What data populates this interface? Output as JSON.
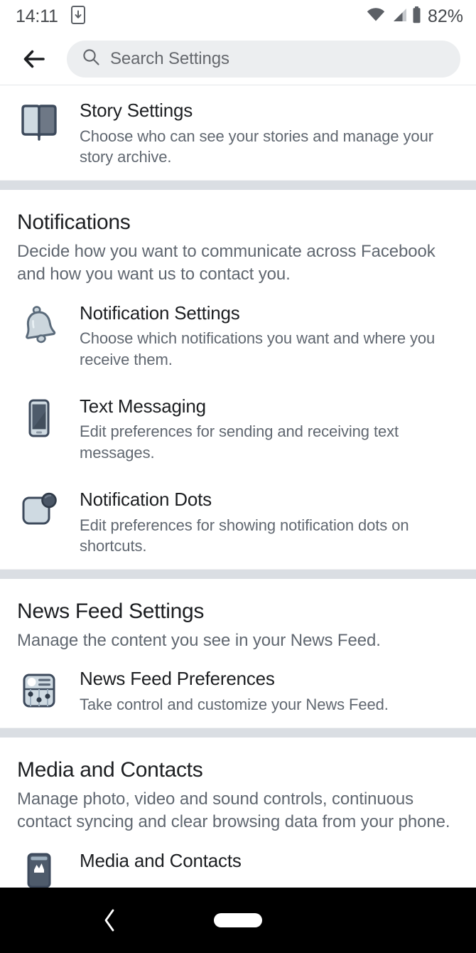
{
  "status_bar": {
    "time": "14:11",
    "battery_percent": "82%",
    "icons": [
      "phone-download-icon",
      "wifi-icon",
      "cellular-signal-icon",
      "battery-icon"
    ]
  },
  "header": {
    "back_label": "back-arrow",
    "search_placeholder": "Search Settings",
    "search_value": ""
  },
  "sections": [
    {
      "id": "story",
      "title": "",
      "subtitle": "",
      "rows": [
        {
          "icon": "book-icon",
          "title": "Story Settings",
          "subtitle": "Choose who can see your stories and manage your story archive."
        }
      ]
    },
    {
      "id": "notifications",
      "title": "Notifications",
      "subtitle": "Decide how you want to communicate across Facebook and how you want us to contact you.",
      "rows": [
        {
          "icon": "bell-icon",
          "title": "Notification Settings",
          "subtitle": "Choose which notifications you want and where you receive them."
        },
        {
          "icon": "smartphone-icon",
          "title": "Text Messaging",
          "subtitle": "Edit preferences for sending and receiving text messages."
        },
        {
          "icon": "notification-dot-icon",
          "title": "Notification Dots",
          "subtitle": "Edit preferences for showing notification dots on shortcuts."
        }
      ]
    },
    {
      "id": "news-feed",
      "title": "News Feed Settings",
      "subtitle": "Manage the content you see in your News Feed.",
      "rows": [
        {
          "icon": "news-feed-card-icon",
          "title": "News Feed Preferences",
          "subtitle": "Take control and customize your News Feed."
        }
      ]
    },
    {
      "id": "media-contacts",
      "title": "Media and Contacts",
      "subtitle": "Manage photo, video and sound controls, continuous contact syncing and clear browsing data from your phone.",
      "rows": [
        {
          "icon": "media-contacts-icon",
          "title": "Media and Contacts",
          "subtitle": ""
        }
      ]
    }
  ],
  "nav_bar": {
    "back_label": "back",
    "home_label": "home"
  },
  "colors": {
    "page_bg": "#ffffff",
    "divider": "#dadee3",
    "title_text": "#1c1e21",
    "subtitle_text": "#606770",
    "search_bg": "#eceef0",
    "nav_bg": "#000000",
    "icon_outline": "#3a4a5c",
    "icon_light": "#ccd6dd",
    "icon_mid": "#6d7885"
  }
}
